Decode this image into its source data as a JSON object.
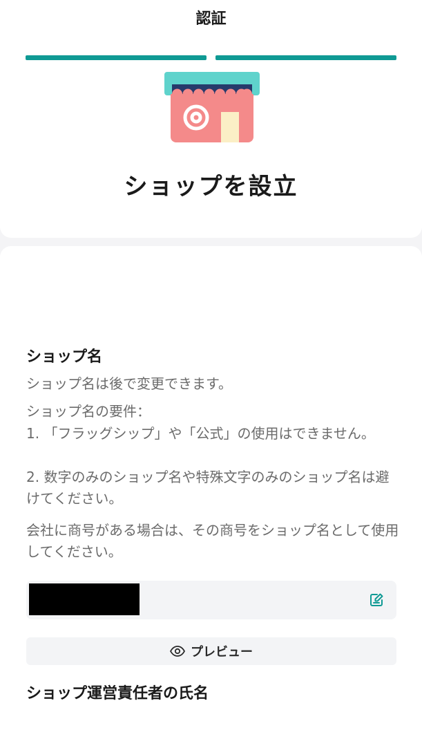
{
  "header": {
    "title": "認証"
  },
  "progress": {
    "steps_total": 2,
    "steps_complete": 2,
    "color": "#0f9a94"
  },
  "hero": {
    "icon": "shop-icon",
    "title": "ショップを設立"
  },
  "shop_name": {
    "label": "ショップ名",
    "hint": "ショップ名は後で変更できます。",
    "requirements_title": "ショップ名の要件：",
    "requirement_1": "1. 「フラッグシップ」や「公式」の使用はできません。",
    "requirement_2": "2. 数字のみのショップ名や特殊文字のみのショップ名は避けてください。",
    "company_note": "会社に商号がある場合は、その商号をショップ名として使用してください。",
    "input_value_redacted": true,
    "edit_icon": "edit-icon",
    "preview_icon": "eye-icon",
    "preview_label": "プレビュー"
  },
  "manager": {
    "label": "ショップ運営責任者の氏名"
  },
  "colors": {
    "accent": "#0f9a94",
    "awning": "#5fd3cc",
    "shop_body": "#f48a8a",
    "scallop": "#263a6b"
  }
}
